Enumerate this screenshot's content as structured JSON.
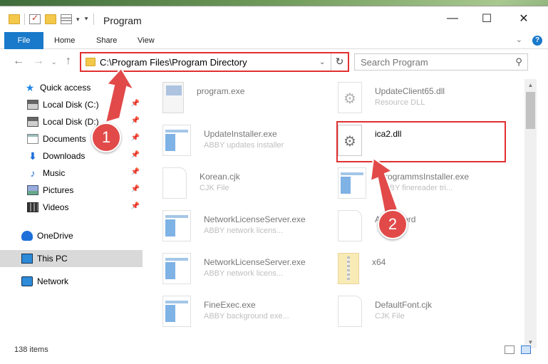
{
  "window": {
    "title": "Program"
  },
  "ribbon": {
    "tabs": [
      "File",
      "Home",
      "Share",
      "View"
    ],
    "help": "?"
  },
  "nav": {
    "address": "C:\\Program Files\\Program Directory",
    "search_placeholder": "Search Program"
  },
  "sidebar": {
    "items": [
      {
        "label": "Quick access",
        "icon": "star-icon",
        "pinned": false
      },
      {
        "label": "Local Disk (C:)",
        "icon": "drive-icon",
        "pinned": true
      },
      {
        "label": "Local Disk (D:)",
        "icon": "drive-icon",
        "pinned": true
      },
      {
        "label": "Documents",
        "icon": "documents-icon",
        "pinned": true
      },
      {
        "label": "Downloads",
        "icon": "download-icon",
        "pinned": true
      },
      {
        "label": "Music",
        "icon": "music-icon",
        "pinned": true
      },
      {
        "label": "Pictures",
        "icon": "pictures-icon",
        "pinned": true
      },
      {
        "label": "Videos",
        "icon": "video-icon",
        "pinned": true
      },
      {
        "label": "OneDrive",
        "icon": "cloud-icon",
        "pinned": false
      },
      {
        "label": "This PC",
        "icon": "computer-icon",
        "pinned": false,
        "selected": true
      },
      {
        "label": "Network",
        "icon": "network-icon",
        "pinned": false
      }
    ]
  },
  "files": [
    {
      "name": "program.exe",
      "desc": "",
      "type": "setup"
    },
    {
      "name": "UpdateClient65.dll",
      "desc": "Resource DLL",
      "type": "dll"
    },
    {
      "name": "UpdateInstaller.exe",
      "desc": "ABBY updates installer",
      "type": "exe"
    },
    {
      "name": "ica2.dll",
      "desc": "",
      "type": "dll"
    },
    {
      "name": "Korean.cjk",
      "desc": "CJK File",
      "type": "doc"
    },
    {
      "name": "ProgrammsInstaller.exe",
      "desc": "ABBY finereader tri...",
      "type": "exe"
    },
    {
      "name": "NetworkLicenseServer.exe",
      "desc": "ABBY network licens...",
      "type": "exe"
    },
    {
      "name": "Aboutword",
      "desc": "",
      "type": "doc"
    },
    {
      "name": "NetworkLicenseServer.exe",
      "desc": "ABBY network licens...",
      "type": "exe"
    },
    {
      "name": "x64",
      "desc": "",
      "type": "folder"
    },
    {
      "name": "FineExec.exe",
      "desc": "ABBY background exe...",
      "type": "exe"
    },
    {
      "name": "DefaultFont.cjk",
      "desc": "CJK File",
      "type": "doc"
    }
  ],
  "status": {
    "item_count": "138 items"
  },
  "annotations": {
    "step1": "1",
    "step2": "2",
    "color": "#e24a4a"
  }
}
